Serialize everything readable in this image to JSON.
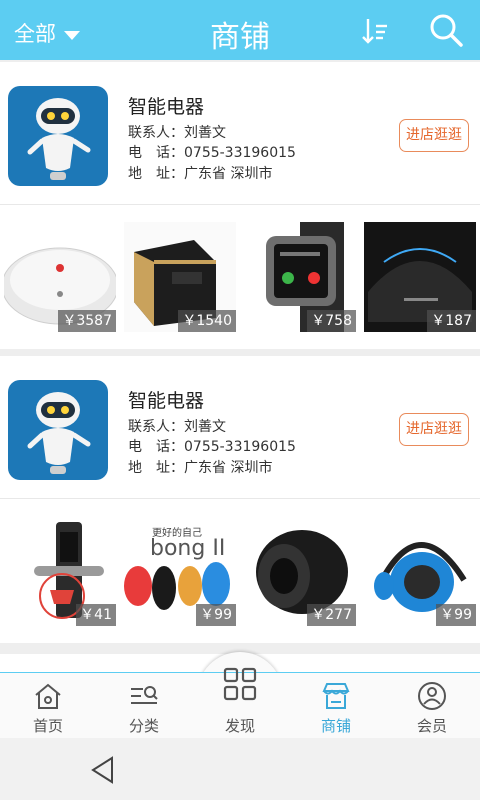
{
  "header": {
    "filter_label": "全部",
    "title": "商铺",
    "sort_icon": "sort-icon",
    "search_icon": "search-icon",
    "bg_color": "#5ccdf2"
  },
  "shops": [
    {
      "name": "智能电器",
      "contact": "联系人：刘善文",
      "phone": "电　话：0755-33196015",
      "address": "地　址：广东省 深圳市",
      "visit_label": "进店逛逛",
      "products": [
        {
          "icon": "robot-vacuum-image",
          "price": "￥3587"
        },
        {
          "icon": "vr-headset-image",
          "price": "￥1540"
        },
        {
          "icon": "smartwatch-image",
          "price": "￥758"
        },
        {
          "icon": "smart-speaker-image",
          "price": "￥187"
        }
      ]
    },
    {
      "name": "智能电器",
      "contact": "联系人：刘善文",
      "phone": "电　话：0755-33196015",
      "address": "地　址：广东省 深圳市",
      "visit_label": "进店逛逛",
      "products": [
        {
          "icon": "smart-door-lock-image",
          "price": "￥41"
        },
        {
          "icon": "bong-band-image",
          "price": "￥99",
          "caption": "bong II",
          "tagline": "更好的自己"
        },
        {
          "icon": "bluetooth-speaker-image",
          "price": "￥277"
        },
        {
          "icon": "headset-image",
          "price": "￥99"
        }
      ]
    }
  ],
  "tabs": [
    {
      "label": "首页",
      "icon": "home-icon"
    },
    {
      "label": "分类",
      "icon": "category-icon"
    },
    {
      "label": "发现",
      "icon": "discover-grid-icon"
    },
    {
      "label": "商铺",
      "icon": "store-icon",
      "active": true
    },
    {
      "label": "会员",
      "icon": "member-icon"
    }
  ],
  "colors": {
    "accent": "#5ccdf2",
    "visit_button": "#e5682e",
    "active_tab": "#3aa8d8"
  }
}
